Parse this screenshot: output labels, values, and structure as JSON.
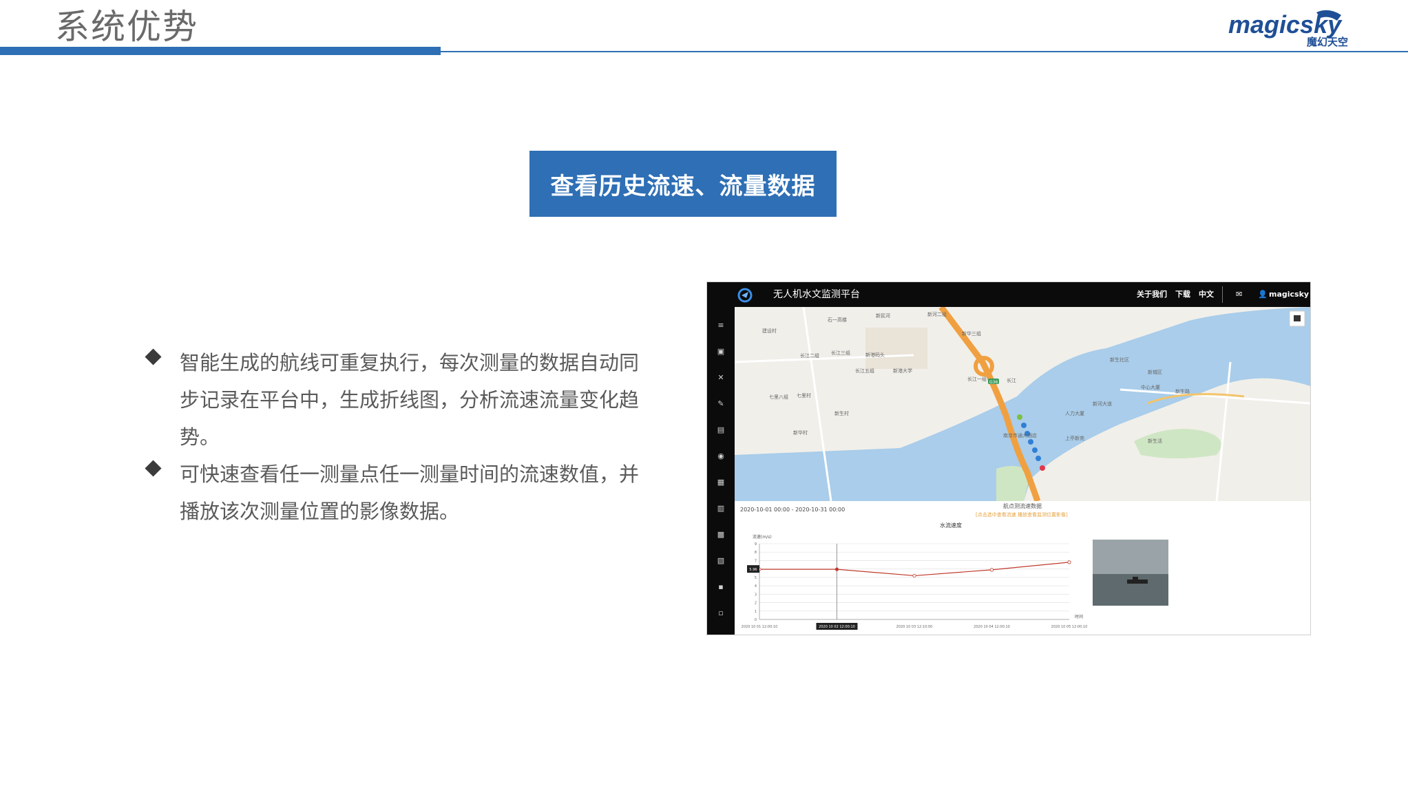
{
  "header": {
    "title": "系统优势"
  },
  "logo": {
    "brand": "magicsky",
    "brand_cn": "魔幻天空"
  },
  "feature": {
    "title": "查看历史流速、流量数据"
  },
  "bullets": [
    "智能生成的航线可重复执行，每次测量的数据自动同步记录在平台中，生成折线图，分析流速流量变化趋势。",
    "可快速查看任一测量点任一测量时间的流速数值，并播放该次测量位置的影像数据。"
  ],
  "app": {
    "title": "无人机水文监测平台",
    "nav": [
      "关于我们",
      "下载",
      "中文"
    ],
    "user": "magicsky",
    "sidebar_icons": [
      "menu-icon",
      "camera-icon",
      "drone-icon",
      "route-icon",
      "list-icon",
      "location-icon",
      "clipboard-icon",
      "chart-icon",
      "image-icon",
      "document-icon",
      "chat-icon",
      "inbox-icon"
    ],
    "colors": {
      "topbar": "#0b0b0b",
      "river": "#a9cdea",
      "route": "#f0a040",
      "points": "#2f7fd6",
      "line": "#c0392b"
    },
    "map": {
      "place_labels": [
        "石一高楼",
        "新民河",
        "新河二组",
        "建设村",
        "长江二组",
        "长江三组",
        "新港码头",
        "长江五组",
        "新港大学",
        "长江",
        "七里八组",
        "七里村",
        "新生村",
        "新华村",
        "新华三组",
        "长江一组",
        "新生社区",
        "人力大厦",
        "南京市通大酒店",
        "新生路",
        "上亭新苑",
        "新河大道",
        "新城区",
        "中心大厦",
        "新生活"
      ],
      "road_label": "G36"
    },
    "panel": {
      "date_range": "2020-10-01 00:00 - 2020-10-31 00:00",
      "panel_title": "航点测流速数据",
      "panel_subtitle": "[点击选中查看流速   播放查看监测位置影像]",
      "chart_title": "水流速度",
      "current_value": "5.96",
      "selected_label": "2020 10 02 12:00:10"
    }
  },
  "chart_data": {
    "type": "line",
    "title": "水流速度",
    "ylabel": "流速(m/s)",
    "xlabel": "时间",
    "categories": [
      "2020 10 01 12:00:10",
      "2020 10 02 12:00:10",
      "2020 10 03 12:10:00",
      "2020 10 04 12:00:10",
      "2020 10 05 12:00:10"
    ],
    "values": [
      5.96,
      5.96,
      5.2,
      5.9,
      6.8
    ],
    "ylim": [
      0,
      9
    ],
    "yticks": [
      0,
      1,
      2,
      3,
      4,
      5,
      6,
      7,
      8,
      9
    ],
    "grid": true
  }
}
